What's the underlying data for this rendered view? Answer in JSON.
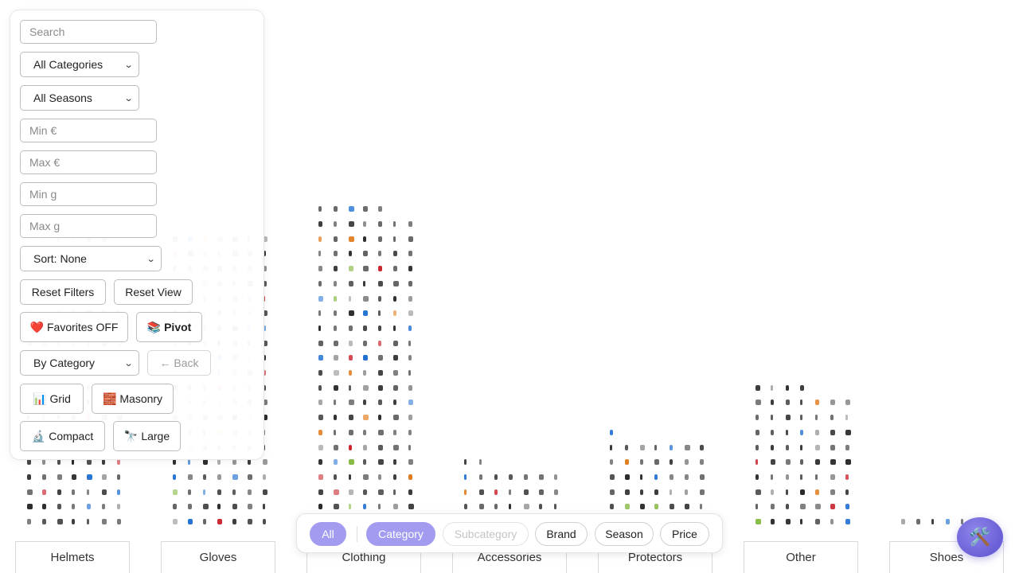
{
  "filters": {
    "search_placeholder": "Search",
    "category_select": "All Categories",
    "season_select": "All Seasons",
    "min_price_placeholder": "Min €",
    "max_price_placeholder": "Max €",
    "min_weight_placeholder": "Min g",
    "max_weight_placeholder": "Max g",
    "sort_select": "Sort: None",
    "reset_filters_label": "Reset Filters",
    "reset_view_label": "Reset View",
    "favorites_label": "Favorites OFF",
    "favorites_icon": "❤️",
    "pivot_label": "Pivot",
    "pivot_icon": "📚",
    "group_select": "By Category",
    "back_label": "← Back",
    "grid_label": "Grid",
    "grid_icon": "📊",
    "masonry_label": "Masonry",
    "masonry_icon": "🧱",
    "compact_label": "Compact",
    "compact_icon": "🔬",
    "large_label": "Large",
    "large_icon": "🔭"
  },
  "toolbar": {
    "all_label": "All",
    "category_label": "Category",
    "subcategory_label": "Subcategory",
    "brand_label": "Brand",
    "season_label": "Season",
    "price_label": "Price"
  },
  "fab_icon": "🛠️",
  "columns": [
    {
      "label": "Helmets",
      "rows": 20,
      "last": 6
    },
    {
      "label": "Gloves",
      "rows": 20,
      "last": 7
    },
    {
      "label": "Clothing",
      "rows": 22,
      "last": 5
    },
    {
      "label": "Accessories",
      "rows": 5,
      "last": 2
    },
    {
      "label": "Protectors",
      "rows": 7,
      "last": 1
    },
    {
      "label": "Other",
      "rows": 10,
      "last": 4
    },
    {
      "label": "Shoes",
      "rows": 1,
      "last": 6
    }
  ],
  "colors": {
    "accent": "#a29bf0",
    "item_dark": "#2b2b2b",
    "item_accents": [
      "#1f6fd1",
      "#c8202a",
      "#7ab32f",
      "#e07a1a",
      "#8e8e8e"
    ]
  }
}
